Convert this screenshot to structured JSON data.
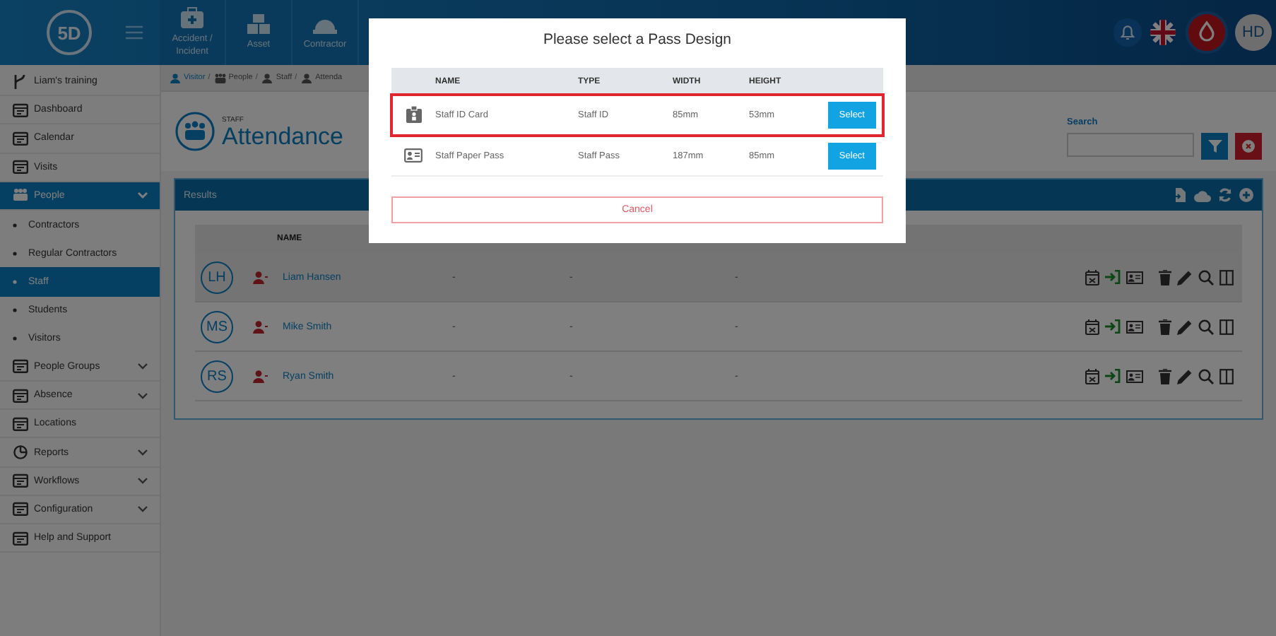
{
  "top_bar": {
    "logo": "5D",
    "modules": [
      {
        "label": "Accident / Incident"
      },
      {
        "label": "Asset"
      },
      {
        "label": "Contractor"
      }
    ],
    "avatar": "HD"
  },
  "sidebar": {
    "items": [
      {
        "label": "Liam's training",
        "selected": false,
        "expandable": false
      },
      {
        "label": "Dashboard",
        "selected": false,
        "expandable": false
      },
      {
        "label": "Calendar",
        "selected": false,
        "expandable": false
      },
      {
        "label": "Visits",
        "selected": false,
        "expandable": false
      },
      {
        "label": "People",
        "selected": true,
        "expandable": true,
        "expanded": true,
        "children": [
          {
            "label": "Contractors",
            "selected": false
          },
          {
            "label": "Regular Contractors",
            "selected": false
          },
          {
            "label": "Staff",
            "selected": true
          },
          {
            "label": "Students",
            "selected": false
          },
          {
            "label": "Visitors",
            "selected": false
          }
        ]
      },
      {
        "label": "People Groups",
        "selected": false,
        "expandable": true,
        "expanded": false
      },
      {
        "label": "Absence",
        "selected": false,
        "expandable": true,
        "expanded": false
      },
      {
        "label": "Locations",
        "selected": false,
        "expandable": false
      },
      {
        "label": "Reports",
        "selected": false,
        "expandable": true,
        "expanded": false
      },
      {
        "label": "Workflows",
        "selected": false,
        "expandable": true,
        "expanded": false
      },
      {
        "label": "Configuration",
        "selected": false,
        "expandable": true,
        "expanded": false
      },
      {
        "label": "Help and Support",
        "selected": false,
        "expandable": false
      }
    ]
  },
  "breadcrumb": [
    {
      "label": "Visitor",
      "separator": "/"
    },
    {
      "label": "People",
      "separator": "/"
    },
    {
      "label": "Staff",
      "separator": "/"
    },
    {
      "label": "Attenda"
    }
  ],
  "page": {
    "section": "STAFF",
    "title": "Attendance"
  },
  "search": {
    "label": "Search"
  },
  "results": {
    "title": "Results",
    "columns": [
      "NAME"
    ],
    "rows": [
      {
        "initials": "LH",
        "name": "Liam Hansen",
        "column_2": "-",
        "column_3": "-",
        "column_4": "-",
        "selected": true
      },
      {
        "initials": "MS",
        "name": "Mike Smith",
        "column_2": "-",
        "column_3": "-",
        "column_4": "-",
        "selected": false
      },
      {
        "initials": "RS",
        "name": "Ryan Smith",
        "column_2": "-",
        "column_3": "-",
        "column_4": "-",
        "selected": false
      }
    ]
  },
  "modal": {
    "title": "Please select a Pass Design",
    "columns": [
      "NAME",
      "TYPE",
      "WIDTH",
      "HEIGHT"
    ],
    "rows": [
      {
        "kind": "badge",
        "name": "Staff ID Card",
        "type": "Staff ID",
        "width": "85mm",
        "height": "53mm",
        "action": "Select",
        "selected": true
      },
      {
        "kind": "card",
        "name": "Staff Paper Pass",
        "type": "Staff Pass",
        "width": "187mm",
        "height": "85mm",
        "action": "Select",
        "selected": false
      }
    ],
    "cancel": "Cancel"
  }
}
